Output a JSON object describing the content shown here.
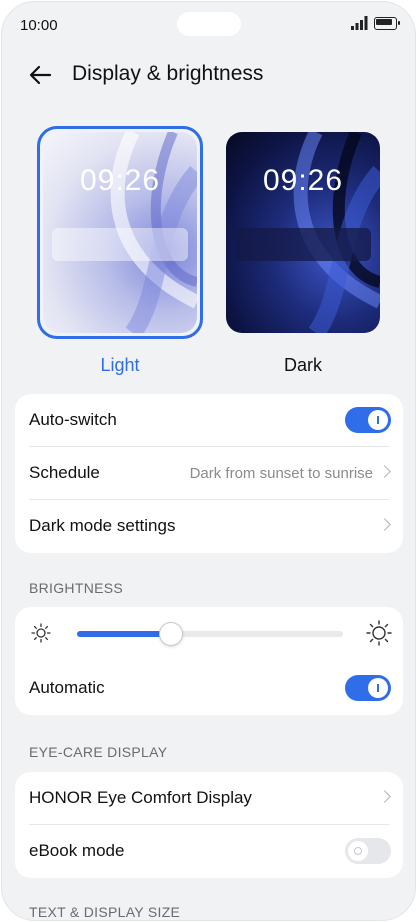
{
  "status_bar": {
    "time": "10:00"
  },
  "header": {
    "title": "Display & brightness"
  },
  "themes": [
    {
      "label": "Light",
      "preview_time": "09:26",
      "selected": true
    },
    {
      "label": "Dark",
      "preview_time": "09:26",
      "selected": false
    }
  ],
  "mode_card": {
    "auto_switch": {
      "label": "Auto-switch",
      "on": true
    },
    "schedule": {
      "label": "Schedule",
      "value": "Dark from sunset to sunrise"
    },
    "dark_mode_settings": {
      "label": "Dark mode settings"
    }
  },
  "brightness": {
    "section_title": "BRIGHTNESS",
    "level": 0.35,
    "automatic": {
      "label": "Automatic",
      "on": true
    }
  },
  "eye_care": {
    "section_title": "EYE-CARE DISPLAY",
    "eye_comfort": {
      "label": "HONOR Eye Comfort Display"
    },
    "ebook_mode": {
      "label": "eBook mode",
      "on": false
    }
  },
  "text_display": {
    "section_title": "TEXT & DISPLAY SIZE"
  },
  "colors": {
    "accent": "#2f6ee8",
    "background": "#f1f2f4"
  }
}
